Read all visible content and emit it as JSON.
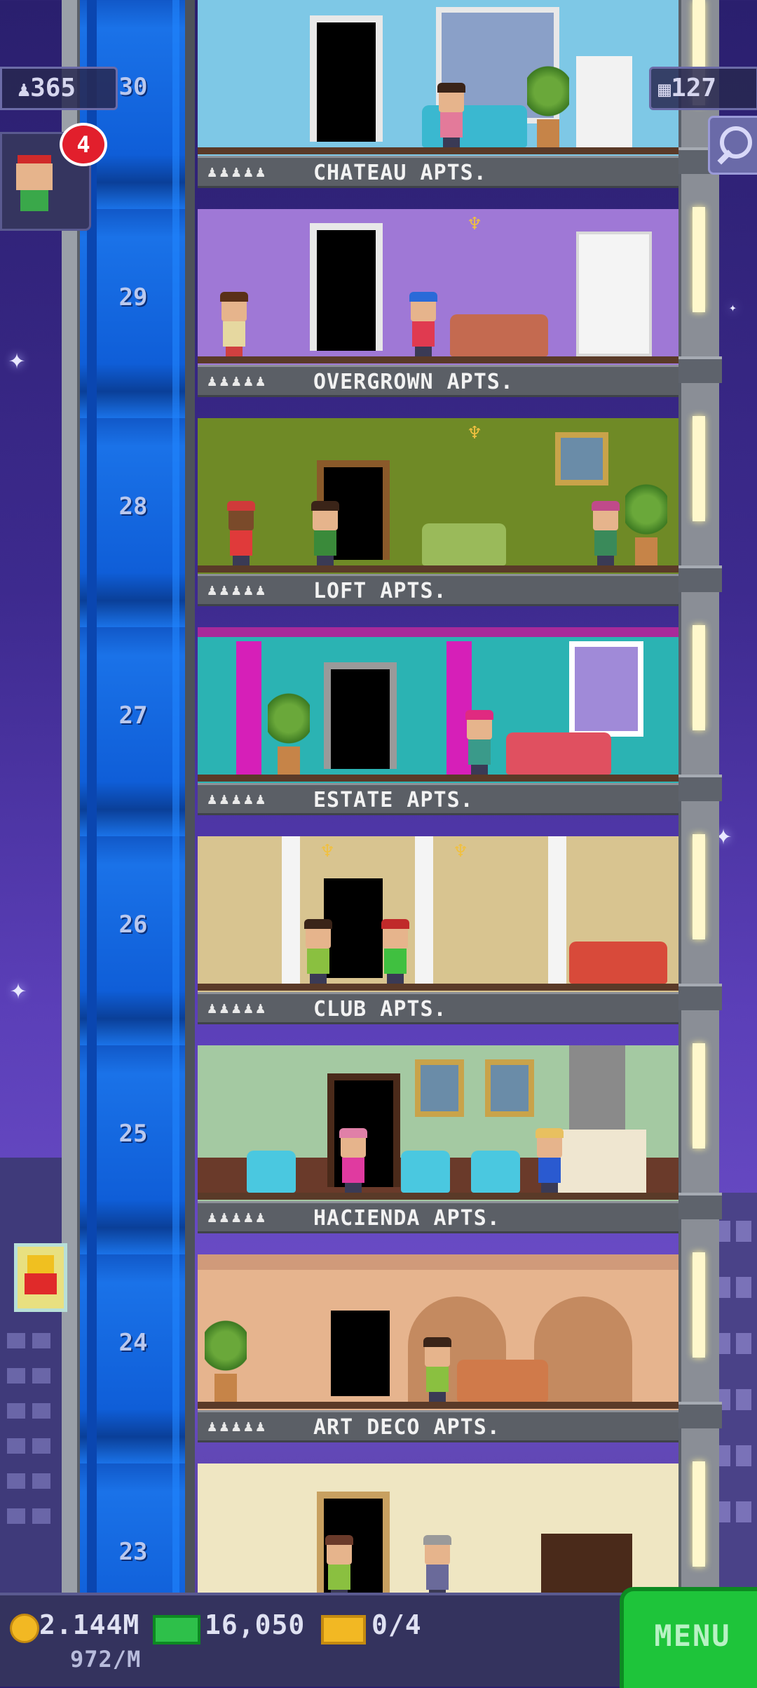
{
  "hud": {
    "population": "365",
    "floors": "127",
    "notification_count": "4"
  },
  "floors": [
    {
      "number": "30",
      "name": "CHATEAU APTS.",
      "residents": "♟♟♟♟♟",
      "wall": "#7ec8e6"
    },
    {
      "number": "29",
      "name": "OVERGROWN APTS.",
      "residents": "♟♟♟♟♟",
      "wall": "#9f78d6"
    },
    {
      "number": "28",
      "name": "LOFT APTS.",
      "residents": "♟♟♟♟♟",
      "wall": "#6f8a26"
    },
    {
      "number": "27",
      "name": "ESTATE APTS.",
      "residents": "♟♟♟♟♟",
      "wall": "#2bb3b3"
    },
    {
      "number": "26",
      "name": "CLUB APTS.",
      "residents": "♟♟♟♟♟",
      "wall": "#d8c490"
    },
    {
      "number": "25",
      "name": "HACIENDA APTS.",
      "residents": "♟♟♟♟♟",
      "wall": "#a4c9a2"
    },
    {
      "number": "24",
      "name": "ART DECO APTS.",
      "residents": "♟♟♟♟♟",
      "wall": "#e6b48e"
    },
    {
      "number": "23",
      "name": "",
      "residents": "",
      "wall": "#efe6c2"
    }
  ],
  "bottom": {
    "coins": "2.144M",
    "coins_rate": "972/M",
    "bux": "16,050",
    "tickets": "0/4",
    "menu_label": "MENU"
  },
  "colors": {
    "elevator": "#1a72e8",
    "menu": "#1ec43a",
    "badge": "#e21f2c"
  }
}
